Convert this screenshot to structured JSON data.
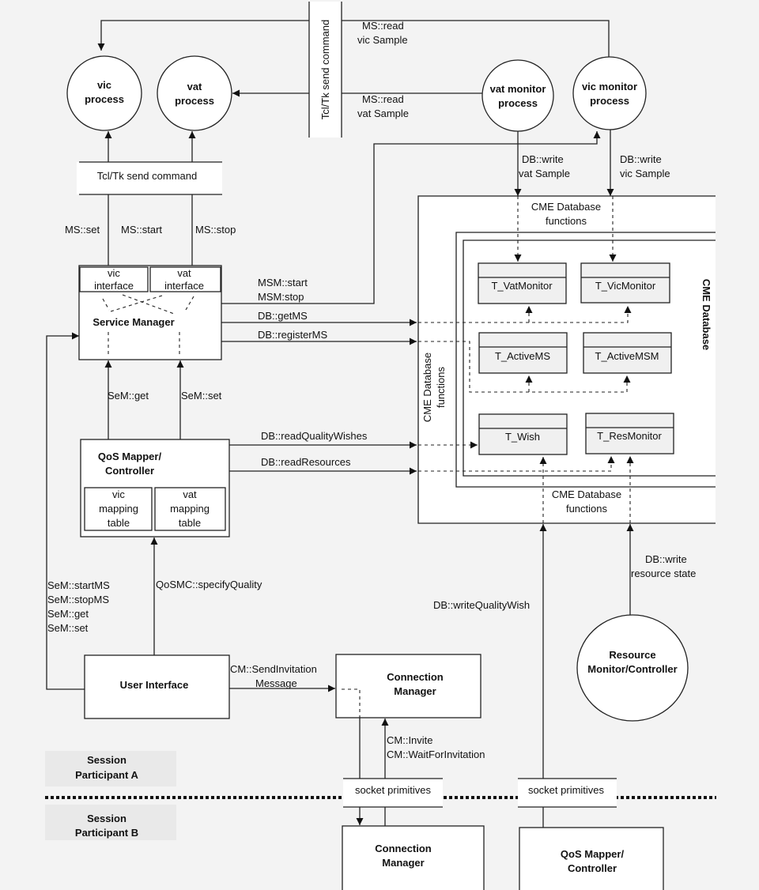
{
  "processes": {
    "vic": [
      "vic",
      "process"
    ],
    "vat": [
      "vat",
      "process"
    ],
    "vat_monitor": [
      "vat monitor",
      "process"
    ],
    "vic_monitor": [
      "vic monitor",
      "process"
    ],
    "resource_monitor": [
      "Resource",
      "Monitor/Controller"
    ]
  },
  "tcltk_vertical": "Tcl/Tk send command",
  "tcltk_horizontal": "Tcl/Tk send command",
  "labels": {
    "ms_read_vic": [
      "MS::read",
      "vic Sample"
    ],
    "ms_read_vat": [
      "MS::read",
      "vat Sample"
    ],
    "ms_set": "MS::set",
    "ms_start": "MS::start",
    "ms_stop": "MS::stop",
    "db_write_vat": [
      "DB::write",
      "vat Sample"
    ],
    "db_write_vic": [
      "DB::write",
      "vic Sample"
    ],
    "msm": [
      "MSM::start",
      "MSM:stop"
    ],
    "db_getms": "DB::getMS",
    "db_registerms": "DB::registerMS",
    "sem_get": "SeM::get",
    "sem_set": "SeM::set",
    "db_readqualitywishes": "DB::readQualityWishes",
    "db_readresources": "DB::readResources",
    "qosmc": "QoSMC::specifyQuality",
    "sem_list": [
      "SeM::startMS",
      "SeM::stopMS",
      "SeM::get",
      "SeM::set"
    ],
    "cm_send": [
      "CM::SendInvitation",
      "Message"
    ],
    "cm_invite": [
      "CM::Invite",
      "CM::WaitForInvitation"
    ],
    "db_writequalitywish": "DB::writeQualityWish",
    "db_write_resource": [
      "DB::write",
      "resource state"
    ]
  },
  "service_manager": {
    "title": "Service Manager",
    "vic_interface": [
      "vic",
      "interface"
    ],
    "vat_interface": [
      "vat",
      "interface"
    ]
  },
  "qos_mapper": {
    "title": [
      "QoS Mapper/",
      "Controller"
    ],
    "vic_table": [
      "vic",
      "mapping",
      "table"
    ],
    "vat_table": [
      "vat",
      "mapping",
      "table"
    ]
  },
  "database": {
    "title": "CME Database",
    "functions_top": [
      "CME Database",
      "functions"
    ],
    "functions_left": [
      "CME Database",
      "functions"
    ],
    "functions_bottom": [
      "CME Database",
      "functions"
    ],
    "tables": [
      "T_VatMonitor",
      "T_VicMonitor",
      "T_ActiveMS",
      "T_ActiveMSM",
      "T_Wish",
      "T_ResMonitor"
    ]
  },
  "user_interface": "User Interface",
  "connection_manager_a": [
    "Connection",
    "Manager"
  ],
  "connection_manager_b": [
    "Connection",
    "Manager"
  ],
  "qos_mapper_b": [
    "QoS Mapper/",
    "Controller"
  ],
  "socket_a": "socket primitives",
  "socket_b": "socket primitives",
  "participant_a": [
    "Session",
    "Participant A"
  ],
  "participant_b": [
    "Session",
    "Participant B"
  ]
}
